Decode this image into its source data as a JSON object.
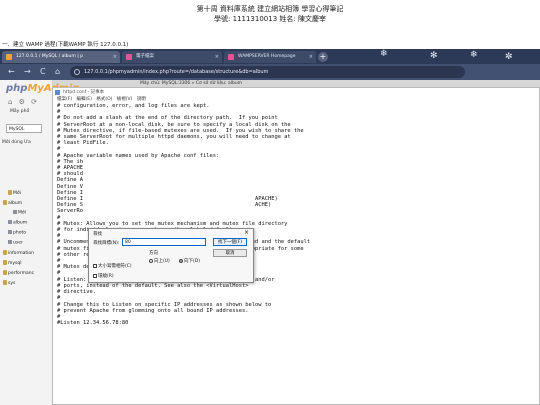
{
  "document": {
    "title": "第十周 資料庫系統 建立網站相簿 學習心得筆記",
    "student_line": "學號: 1111310013 姓名: 陳文慶宰",
    "section_heading": "一、建立 WAMP 過程(下載WAMP 執行 127.0.0.1)"
  },
  "browser": {
    "tabs": [
      {
        "label": "127.0.0.1 / MySQL / album | p",
        "color": "#f0a43a"
      },
      {
        "label": "電子檔案",
        "color": "#e25594"
      },
      {
        "label": "WAMPSERVER Homepage",
        "color": "#e25594"
      }
    ],
    "url": "127.0.0.1/phpmyadmin/index.php?route=/database/structure&db=album",
    "nav": {
      "back": "←",
      "forward": "→",
      "reload": "C",
      "home": "⌂"
    }
  },
  "phpmyadmin": {
    "logo_main": "php",
    "logo_accent": "MyAdmin",
    "recent_label": "Mầy phổ",
    "server_box": "MySQL",
    "recent_tabs": "Mới dùng   Ưa",
    "breadcrumb": "Máy chủ: MySQL:3306 » Cơ sở dữ liệu: album",
    "tree": [
      {
        "label": "Mới",
        "indent": 1,
        "kind": "db"
      },
      {
        "label": "album",
        "indent": 0,
        "kind": "db"
      },
      {
        "label": "Mới",
        "indent": 2,
        "kind": "table"
      },
      {
        "label": "album",
        "indent": 1,
        "kind": "table"
      },
      {
        "label": "photo",
        "indent": 1,
        "kind": "table"
      },
      {
        "label": "user",
        "indent": 1,
        "kind": "table"
      },
      {
        "label": "information",
        "indent": 0,
        "kind": "db"
      },
      {
        "label": "mysql",
        "indent": 0,
        "kind": "db"
      },
      {
        "label": "performanc",
        "indent": 0,
        "kind": "db"
      },
      {
        "label": "sys",
        "indent": 0,
        "kind": "db"
      }
    ]
  },
  "notepad": {
    "title": "httpd.conf - 記事本",
    "menu": "檔案(F)  編輯(E)  格式(O)  檢視(V)  說明",
    "lines": [
      "# configuration, error, and log files are kept.",
      "#",
      "# Do not add a slash at the end of the directory path.  If you point",
      "# ServerRoot at a non-local disk, be sure to specify a local disk on the",
      "# Mutex directive, if file-based mutexes are used.  If you wish to share the",
      "# same ServerRoot for multiple httpd daemons, you will need to change at",
      "# least PidFile.",
      "#",
      "# Apache variable names used by Apache conf files:",
      "# The ih",
      "# APACHE",
      "# should",
      "Define A",
      "Define V",
      "Define I",
      "Define I                                                     APACHE)",
      "Define S                                                     ACHE)",
      "",
      "ServerRo",
      "",
      "#",
      "# Mutex: Allows you to set the mutex mechanism and mutex file directory",
      "# for individual mutexes, or change the global defaults",
      "#",
      "# Uncomment and change the directory if mutexes are file-based and the default",
      "# mutex file directory is not on a local disk or is not appropriate for some",
      "# other reason.",
      "#",
      "# Mutex default:logs",
      "",
      "#",
      "# Listen: Allows you to bind Apache to specific IP addresses and/or",
      "# ports, instead of the default. See also the <VirtualHost>",
      "# directive.",
      "#",
      "# Change this to Listen on specific IP addresses as shown below to",
      "# prevent Apache from glomming onto all bound IP addresses.",
      "#",
      "#Listen 12.34.56.78:80"
    ]
  },
  "find_dialog": {
    "title": "尋找",
    "close": "×",
    "find_label": "尋找目標(N):",
    "find_value": "80",
    "find_next": "找下一個(F)",
    "cancel": "取消",
    "direction_label": "方向",
    "up": "向上(U)",
    "down": "向下(D)",
    "match_case": "大小寫需相符(C)",
    "wrap": "環繞(R)"
  }
}
